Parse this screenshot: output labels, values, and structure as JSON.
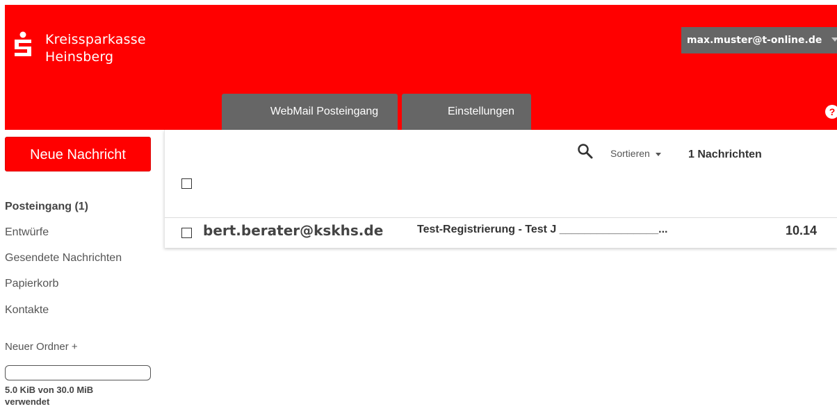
{
  "header": {
    "bank_name_line1": "Kreissparkasse",
    "bank_name_line2": "Heinsberg",
    "user_email": "max.muster@t-online.de",
    "help_label": "?",
    "tabs": [
      {
        "label": "WebMail Posteingang"
      },
      {
        "label": "Einstellungen"
      }
    ]
  },
  "sidebar": {
    "new_message_label": "Neue Nachricht",
    "folders": [
      {
        "label": "Posteingang (1)"
      },
      {
        "label": "Entwürfe"
      },
      {
        "label": "Gesendete Nachrichten"
      },
      {
        "label": "Papierkorb"
      },
      {
        "label": "Kontakte"
      }
    ],
    "new_folder_label": "Neuer Ordner +",
    "quota_text": "5.0 KiB von 30.0 MiB verwendet"
  },
  "list": {
    "sort_label": "Sortieren",
    "count_label": "1 Nachrichten",
    "messages": [
      {
        "sender": "bert.berater@kskhs.de",
        "subject": "Test-Registrierung - Test J ________________...",
        "date": "10.14"
      }
    ]
  },
  "colors": {
    "brand_red": "#ff0000",
    "tab_gray": "#666666"
  },
  "icons": {
    "logo": "sparkasse-s-logo-icon",
    "search": "search-icon",
    "sort": "chevron-down-icon",
    "help": "help-icon"
  }
}
